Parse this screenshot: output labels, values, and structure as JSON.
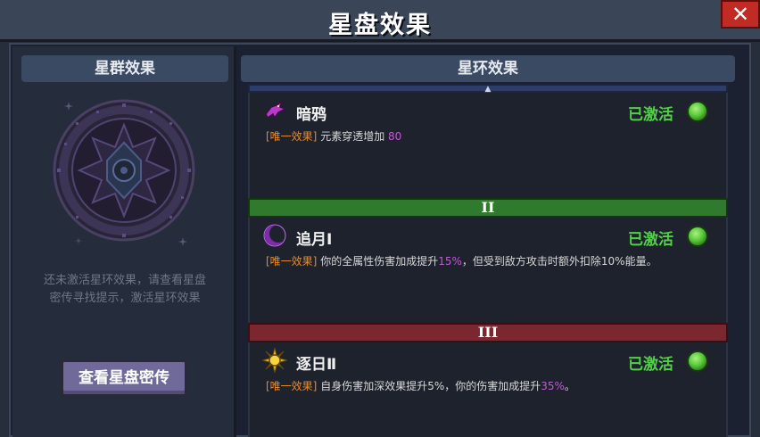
{
  "window": {
    "title": "星盘效果",
    "close_label": "✕"
  },
  "left": {
    "header": "星群效果",
    "hint_line1": "还未激活星环效果，请查看星盘",
    "hint_line2": "密传寻找提示，激活星环效果",
    "button_label": "查看星盘密传"
  },
  "right": {
    "header": "星环效果",
    "top_marker": "▲",
    "tiers": [
      {
        "name": "暗鸦",
        "status": "已激活",
        "tag": "[唯一效果]",
        "desc_pre": "元素穿透增加 ",
        "desc_hl": "80",
        "desc_post": ""
      },
      {
        "divider": "II",
        "name": "追月Ⅰ",
        "status": "已激活",
        "tag": "[唯一效果]",
        "desc_pre": "你的全属性伤害加成提升",
        "desc_hl": "15%",
        "desc_post": "，但受到敌方攻击时额外扣除10%能量。"
      },
      {
        "divider": "III",
        "name": "逐日Ⅱ",
        "status": "已激活",
        "tag": "[唯一效果]",
        "desc_pre": "自身伤害加深效果提升5%，你的伤害加成提升",
        "desc_hl": "35%",
        "desc_post": "。"
      }
    ]
  },
  "colors": {
    "active_green": "#52d147",
    "tier2_bar": "#2f7a2c",
    "tier3_bar": "#7a2730",
    "tag_orange": "#e88a2c",
    "highlight_purple": "#c15ad6"
  },
  "icons": [
    "close-icon",
    "starmap-emblem",
    "crow-icon",
    "crescent-moon-icon",
    "sun-icon",
    "status-orb-icon"
  ]
}
